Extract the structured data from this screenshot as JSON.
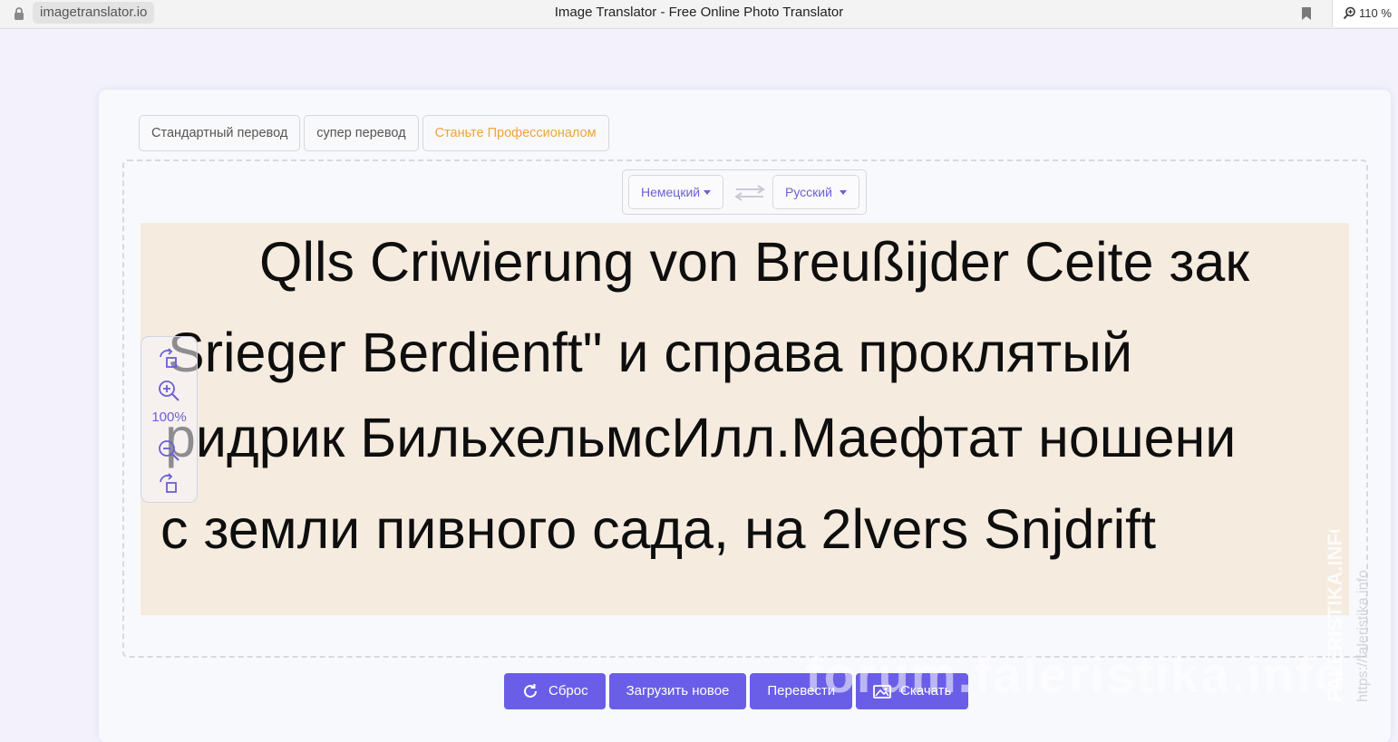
{
  "browser": {
    "url": "imagetranslator.io",
    "title": "Image Translator - Free Online Photo Translator",
    "zoom": "110 %"
  },
  "tabs": [
    {
      "label": "Стандартный перевод"
    },
    {
      "label": "супер перевод"
    },
    {
      "label": "Станьте Профессионалом"
    }
  ],
  "languages": {
    "source": "Немецкий",
    "target": "Русский"
  },
  "image_text": {
    "line1": "Qlls Criwierung von Breußijder Ceite зак",
    "line2": "Srieger Berdienft\" и справа проклятый",
    "line3": "ридрик БильхельмсИлл.Маефтат ношени",
    "line4": "с земли пивного сада, на 2lvers Snjdrift"
  },
  "zoom_level": "100%",
  "actions": {
    "reset": "Сброс",
    "upload": "Загрузить новое",
    "translate": "Перевести",
    "download": "Скачать"
  },
  "watermark": {
    "horizontal": "forum.faleristika.info",
    "vertical_1": "FALERISTIKA.INFO",
    "vertical_2": "https://faleristika.info"
  },
  "colors": {
    "accent": "#6a5ee8",
    "pro_tab": "#f0a33c",
    "page_bg": "#f3f2fc",
    "image_bg": "#f6ebdf"
  },
  "icons": [
    "lock-icon",
    "bookmark-icon",
    "zoom-magnifier-icon",
    "swap-icon",
    "rotate-left-icon",
    "zoom-in-icon",
    "zoom-out-icon",
    "rotate-right-icon",
    "refresh-icon",
    "image-icon"
  ]
}
